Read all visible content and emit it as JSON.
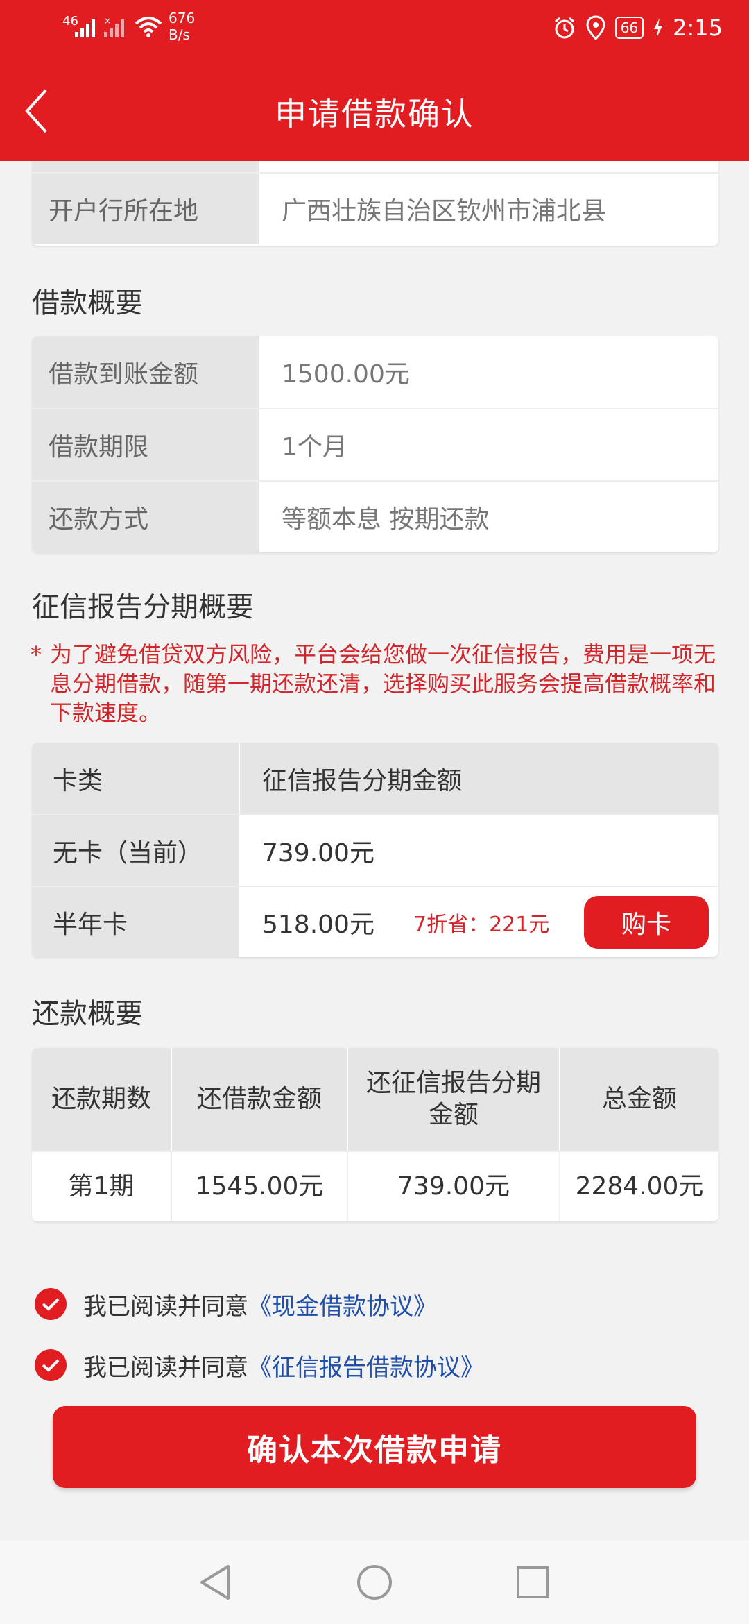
{
  "status_bar": {
    "signal1": "46",
    "net_speed_value": "676",
    "net_speed_unit": "B/s",
    "battery": "66",
    "time": "2:15",
    "icons": [
      "signal-icon",
      "wifi-icon",
      "alarm-icon",
      "location-icon",
      "battery-icon",
      "charging-icon"
    ]
  },
  "header": {
    "title": "申请借款确认",
    "back_icon": "chevron-left-icon"
  },
  "bank_location": {
    "label": "开户行所在地",
    "value": "广西壮族自治区钦州市浦北县"
  },
  "loan_summary": {
    "title": "借款概要",
    "rows": [
      {
        "label": "借款到账金额",
        "value": "1500.00元"
      },
      {
        "label": "借款期限",
        "value": "1个月"
      },
      {
        "label": "还款方式",
        "value": "等额本息 按期还款"
      }
    ]
  },
  "credit_summary": {
    "title": "征信报告分期概要",
    "notice_star": "*",
    "notice": "为了避免借贷双方风险，平台会给您做一次征信报告，费用是一项无息分期借款，随第一期还款还清，选择购买此服务会提高借款概率和下款速度。",
    "header": {
      "col1": "卡类",
      "col2": "征信报告分期金额"
    },
    "rows": [
      {
        "label": "无卡（当前）",
        "value": "739.00元"
      },
      {
        "label": "半年卡",
        "value": "518.00元",
        "discount": "7折省：221元",
        "button": "购卡"
      }
    ]
  },
  "repay_summary": {
    "title": "还款概要",
    "headers": [
      "还款期数",
      "还借款金额",
      "还征信报告分期金额",
      "总金额"
    ],
    "rows": [
      [
        "第1期",
        "1545.00元",
        "739.00元",
        "2284.00元"
      ]
    ]
  },
  "agreements": [
    {
      "prefix": "我已阅读并同意",
      "link": "《现金借款协议》",
      "checked": true
    },
    {
      "prefix": "我已阅读并同意",
      "link": "《征信报告借款协议》",
      "checked": true
    }
  ],
  "confirm_button": "确认本次借款申请",
  "nav_bar": {
    "icons": [
      "back-triangle-icon",
      "home-circle-icon",
      "recents-square-icon"
    ]
  },
  "colors": {
    "brand_red": "#e21d22",
    "link_blue": "#1f4fa8",
    "notice_red": "#d3262b"
  }
}
